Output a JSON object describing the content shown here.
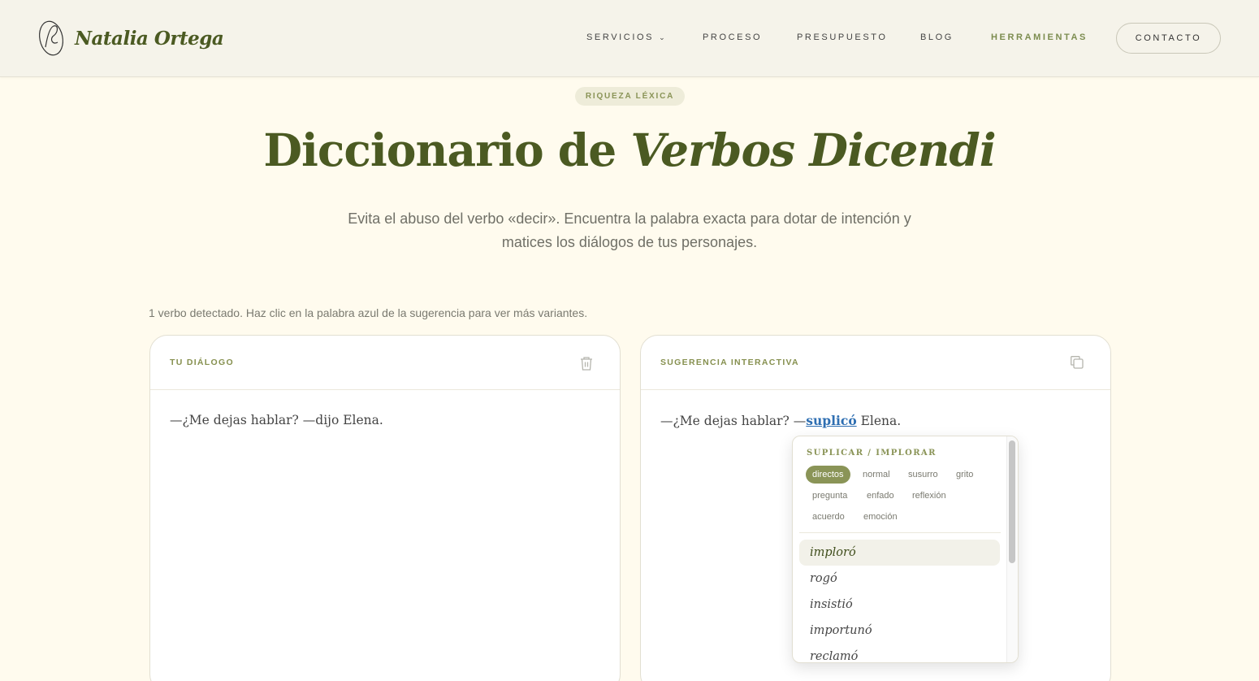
{
  "header": {
    "logo_text": "Natalia Ortega",
    "nav": [
      {
        "label": "SERVICIOS",
        "has_dropdown": true
      },
      {
        "label": "PROCESO"
      },
      {
        "label": "PRESUPUESTO"
      },
      {
        "label": "BLOG"
      },
      {
        "label": "HERRAMIENTAS",
        "active": true
      }
    ],
    "contact_label": "CONTACTO"
  },
  "hero": {
    "badge": "RIQUEZA LÉXICA",
    "title_plain": "Diccionario de",
    "title_italic": "Verbos Dicendi",
    "subtitle": "Evita el abuso del verbo «decir». Encuentra la palabra exacta para dotar de intención y matices los diálogos de tus personajes."
  },
  "hint": "1 verbo detectado. Haz clic en la palabra azul de la sugerencia para ver más variantes.",
  "left_panel": {
    "label": "TU DIÁLOGO",
    "text": "—¿Me dejas hablar? —dijo Elena."
  },
  "right_panel": {
    "label": "SUGERENCIA INTERACTIVA",
    "text_before": "—¿Me dejas hablar? —",
    "suggested_word": "suplicó",
    "text_after": " Elena."
  },
  "dropdown": {
    "title": "SUPLICAR / IMPLORAR",
    "filters": [
      "directos",
      "normal",
      "susurro",
      "grito",
      "pregunta",
      "enfado",
      "reflexión",
      "acuerdo",
      "emoción"
    ],
    "active_filter": "directos",
    "options": [
      "imploró",
      "rogó",
      "insistió",
      "importunó",
      "reclamó"
    ],
    "highlighted_option": "imploró"
  },
  "colors": {
    "brand_green": "#4b5a22",
    "accent_olive": "#8a9457",
    "link_blue": "#2f6fb2",
    "background": "#fffbee"
  }
}
